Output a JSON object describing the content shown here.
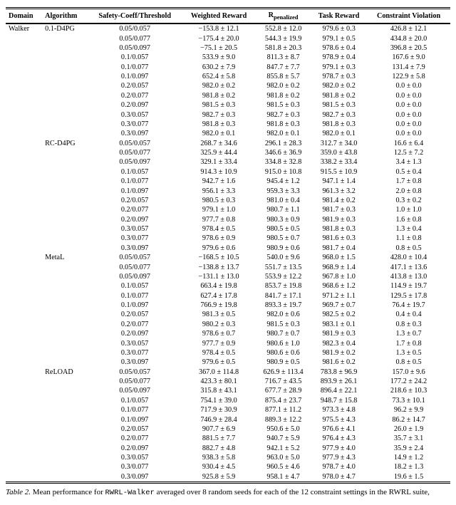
{
  "headers": [
    "Domain",
    "Algorithm",
    "Safety-Coeff/Threshold",
    "Weighted Reward",
    "Rpenalized",
    "Task Reward",
    "Constraint Violation"
  ],
  "penalized_sub": "penalized",
  "domain_value": "Walker",
  "groups": [
    {
      "algo": "0.1-D4PG",
      "rows": [
        [
          "0.05/0.057",
          "−153.8 ± 12.1",
          "552.8 ± 12.0",
          "979.6 ± 0.3",
          "426.8 ± 12.1"
        ],
        [
          "0.05/0.077",
          "−175.4 ± 20.0",
          "544.3 ± 19.9",
          "979.1 ± 0.5",
          "434.8 ± 20.0"
        ],
        [
          "0.05/0.097",
          "−75.1 ± 20.5",
          "581.8 ± 20.3",
          "978.6 ± 0.4",
          "396.8 ± 20.5"
        ],
        [
          "0.1/0.057",
          "533.9 ± 9.0",
          "811.3 ± 8.7",
          "978.9 ± 0.4",
          "167.6 ± 9.0"
        ],
        [
          "0.1/0.077",
          "630.2 ± 7.9",
          "847.7 ± 7.7",
          "979.1 ± 0.3",
          "131.4 ± 7.9"
        ],
        [
          "0.1/0.097",
          "652.4 ± 5.8",
          "855.8 ± 5.7",
          "978.7 ± 0.3",
          "122.9 ± 5.8"
        ],
        [
          "0.2/0.057",
          "982.0 ± 0.2",
          "982.0 ± 0.2",
          "982.0 ± 0.2",
          "0.0 ± 0.0"
        ],
        [
          "0.2/0.077",
          "981.8 ± 0.2",
          "981.8 ± 0.2",
          "981.8 ± 0.2",
          "0.0 ± 0.0"
        ],
        [
          "0.2/0.097",
          "981.5 ± 0.3",
          "981.5 ± 0.3",
          "981.5 ± 0.3",
          "0.0 ± 0.0"
        ],
        [
          "0.3/0.057",
          "982.7 ± 0.3",
          "982.7 ± 0.3",
          "982.7 ± 0.3",
          "0.0 ± 0.0"
        ],
        [
          "0.3/0.077",
          "981.8 ± 0.3",
          "981.8 ± 0.3",
          "981.8 ± 0.3",
          "0.0 ± 0.0"
        ],
        [
          "0.3/0.097",
          "982.0 ± 0.1",
          "982.0 ± 0.1",
          "982.0 ± 0.1",
          "0.0 ± 0.0"
        ]
      ]
    },
    {
      "algo": "RC-D4PG",
      "rows": [
        [
          "0.05/0.057",
          "268.7 ± 34.6",
          "296.1 ± 28.3",
          "312.7 ± 34.0",
          "16.6 ± 6.4"
        ],
        [
          "0.05/0.077",
          "325.9 ± 44.4",
          "346.6 ± 36.9",
          "359.0 ± 43.8",
          "12.5 ± 7.2"
        ],
        [
          "0.05/0.097",
          "329.1 ± 33.4",
          "334.8 ± 32.8",
          "338.2 ± 33.4",
          "3.4 ± 1.3"
        ],
        [
          "0.1/0.057",
          "914.3 ± 10.9",
          "915.0 ± 10.8",
          "915.5 ± 10.9",
          "0.5 ± 0.4"
        ],
        [
          "0.1/0.077",
          "942.7 ± 1.6",
          "945.4 ± 1.2",
          "947.1 ± 1.4",
          "1.7 ± 0.8"
        ],
        [
          "0.1/0.097",
          "956.1 ± 3.3",
          "959.3 ± 3.3",
          "961.3 ± 3.2",
          "2.0 ± 0.8"
        ],
        [
          "0.2/0.057",
          "980.5 ± 0.3",
          "981.0 ± 0.4",
          "981.4 ± 0.2",
          "0.3 ± 0.2"
        ],
        [
          "0.2/0.077",
          "979.1 ± 1.0",
          "980.7 ± 1.1",
          "981.7 ± 0.3",
          "1.0 ± 1.0"
        ],
        [
          "0.2/0.097",
          "977.7 ± 0.8",
          "980.3 ± 0.9",
          "981.9 ± 0.3",
          "1.6 ± 0.8"
        ],
        [
          "0.3/0.057",
          "978.4 ± 0.5",
          "980.5 ± 0.5",
          "981.8 ± 0.3",
          "1.3 ± 0.4"
        ],
        [
          "0.3/0.077",
          "978.6 ± 0.9",
          "980.5 ± 0.7",
          "981.6 ± 0.3",
          "1.1 ± 0.8"
        ],
        [
          "0.3/0.097",
          "979.6 ± 0.6",
          "980.9 ± 0.6",
          "981.7 ± 0.4",
          "0.8 ± 0.5"
        ]
      ]
    },
    {
      "algo": "MetaL",
      "rows": [
        [
          "0.05/0.057",
          "−168.5 ± 10.5",
          "540.0 ± 9.6",
          "968.0 ± 1.5",
          "428.0 ± 10.4"
        ],
        [
          "0.05/0.077",
          "−138.8 ± 13.7",
          "551.7 ± 13.5",
          "968.9 ± 1.4",
          "417.1 ± 13.6"
        ],
        [
          "0.05/0.097",
          "−131.1 ± 13.0",
          "553.9 ± 12.2",
          "967.8 ± 1.0",
          "413.8 ± 13.0"
        ],
        [
          "0.1/0.057",
          "663.4 ± 19.8",
          "853.7 ± 19.8",
          "968.6 ± 1.2",
          "114.9 ± 19.7"
        ],
        [
          "0.1/0.077",
          "627.4 ± 17.8",
          "841.7 ± 17.1",
          "971.2 ± 1.1",
          "129.5 ± 17.8"
        ],
        [
          "0.1/0.097",
          "766.9 ± 19.8",
          "893.3 ± 19.7",
          "969.7 ± 0.7",
          "76.4 ± 19.7"
        ],
        [
          "0.2/0.057",
          "981.3 ± 0.5",
          "982.0 ± 0.6",
          "982.5 ± 0.2",
          "0.4 ± 0.4"
        ],
        [
          "0.2/0.077",
          "980.2 ± 0.3",
          "981.5 ± 0.3",
          "983.1 ± 0.1",
          "0.8 ± 0.3"
        ],
        [
          "0.2/0.097",
          "978.6 ± 0.7",
          "980.7 ± 0.7",
          "981.9 ± 0.3",
          "1.3 ± 0.7"
        ],
        [
          "0.3/0.057",
          "977.7 ± 0.9",
          "980.6 ± 1.0",
          "982.3 ± 0.4",
          "1.7 ± 0.8"
        ],
        [
          "0.3/0.077",
          "978.4 ± 0.5",
          "980.6 ± 0.6",
          "981.9 ± 0.2",
          "1.3 ± 0.5"
        ],
        [
          "0.3/0.097",
          "979.6 ± 0.5",
          "980.9 ± 0.5",
          "981.6 ± 0.2",
          "0.8 ± 0.5"
        ]
      ]
    },
    {
      "algo": "ReLOAD",
      "rows": [
        [
          "0.05/0.057",
          "367.0 ± 114.8",
          "626.9 ± 113.4",
          "783.8 ± 96.9",
          "157.0 ± 9.6"
        ],
        [
          "0.05/0.077",
          "423.3 ± 80.1",
          "716.7 ± 43.5",
          "893.9 ± 26.1",
          "177.2 ± 24.2"
        ],
        [
          "0.05/0.097",
          "315.8 ± 43.1",
          "677.7 ± 28.9",
          "896.4 ± 22.1",
          "218.6 ± 10.3"
        ],
        [
          "0.1/0.057",
          "754.1 ± 39.0",
          "875.4 ± 23.7",
          "948.7 ± 15.8",
          "73.3 ± 10.1"
        ],
        [
          "0.1/0.077",
          "717.9 ± 30.9",
          "877.1 ± 11.2",
          "973.3 ± 4.8",
          "96.2 ± 9.9"
        ],
        [
          "0.1/0.097",
          "746.9 ± 28.4",
          "889.3 ± 12.2",
          "975.5 ± 4.3",
          "86.2 ± 14.7"
        ],
        [
          "0.2/0.057",
          "907.7 ± 6.9",
          "950.6 ± 5.0",
          "976.6 ± 4.1",
          "26.0 ± 1.9"
        ],
        [
          "0.2/0.077",
          "881.5 ± 7.7",
          "940.7 ± 5.9",
          "976.4 ± 4.3",
          "35.7 ± 3.1"
        ],
        [
          "0.2/0.097",
          "882.7 ± 4.8",
          "942.1 ± 5.2",
          "977.9 ± 4.0",
          "35.9 ± 2.4"
        ],
        [
          "0.3/0.057",
          "938.3 ± 5.8",
          "963.0 ± 5.0",
          "977.9 ± 4.3",
          "14.9 ± 1.2"
        ],
        [
          "0.3/0.077",
          "930.4 ± 4.5",
          "960.5 ± 4.6",
          "978.7 ± 4.0",
          "18.2 ± 1.3"
        ],
        [
          "0.3/0.097",
          "925.8 ± 5.9",
          "958.1 ± 4.7",
          "978.0 ± 4.7",
          "19.6 ± 1.5"
        ]
      ]
    }
  ],
  "caption": {
    "label": "Table 2.",
    "text_before": "Mean performance for ",
    "code": "RWRL-Walker",
    "text_after": " averaged over 8 random seeds for each of the 12 constraint settings in the RWRL suite,"
  }
}
